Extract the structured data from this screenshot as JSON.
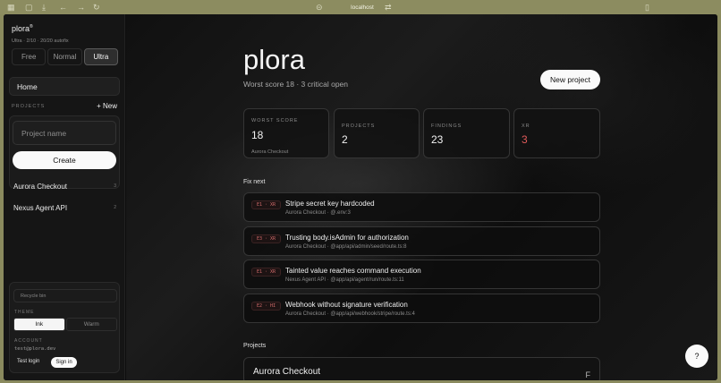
{
  "browser": {
    "url": "localhost"
  },
  "sidebar": {
    "brand": "plora",
    "brand_mark": "®",
    "plan_status": "Ultra · 2/10 · 20/20 autofix",
    "plans": [
      "Free",
      "Normal",
      "Ultra"
    ],
    "active_plan": "Ultra",
    "home_label": "Home",
    "projects_label": "PROJECTS",
    "new_label": "+ New",
    "project_placeholder": "Project name",
    "create_label": "Create",
    "projects": [
      {
        "name": "Aurora Checkout",
        "count": "3"
      },
      {
        "name": "Nexus Agent API",
        "count": "2"
      }
    ],
    "recycle_label": "Recycle bin",
    "theme_label": "THEME",
    "themes": [
      "Ink",
      "Warm"
    ],
    "active_theme": "Ink",
    "account_label": "ACCOUNT",
    "account_email": "test@plora.dev",
    "test_login_label": "Test login",
    "sign_in_label": "Sign in"
  },
  "main": {
    "title": "plora",
    "subtitle": "Worst score 18 · 3 critical open",
    "new_project_label": "New project",
    "stats": [
      {
        "label": "WORST SCORE",
        "value": "18",
        "note": "Aurora Checkout"
      },
      {
        "label": "PROJECTS",
        "value": "2",
        "note": ""
      },
      {
        "label": "FINDINGS",
        "value": "23",
        "note": ""
      },
      {
        "label": "XR",
        "value": "3",
        "note": "",
        "value_color": "#e05a5a"
      }
    ],
    "fix_next_label": "Fix next",
    "findings": [
      {
        "badge_a": "E1",
        "badge_b": "XR",
        "title": "Stripe secret key hardcoded",
        "subtitle": "Aurora Checkout · @.env:3"
      },
      {
        "badge_a": "E3",
        "badge_b": "XR",
        "title": "Trusting body.isAdmin for authorization",
        "subtitle": "Aurora Checkout · @app/api/admin/seed/route.ts:8"
      },
      {
        "badge_a": "E1",
        "badge_b": "XR",
        "title": "Tainted value reaches command execution",
        "subtitle": "Nexus Agent API · @app/api/agent/run/route.ts:11"
      },
      {
        "badge_a": "E2",
        "badge_b": "HI",
        "title": "Webhook without signature verification",
        "subtitle": "Aurora Checkout · @app/api/webhook/stripe/route.ts:4"
      }
    ],
    "projects_label": "Projects",
    "project_card": {
      "name": "Aurora Checkout",
      "grade": "F"
    },
    "help_label": "?"
  }
}
